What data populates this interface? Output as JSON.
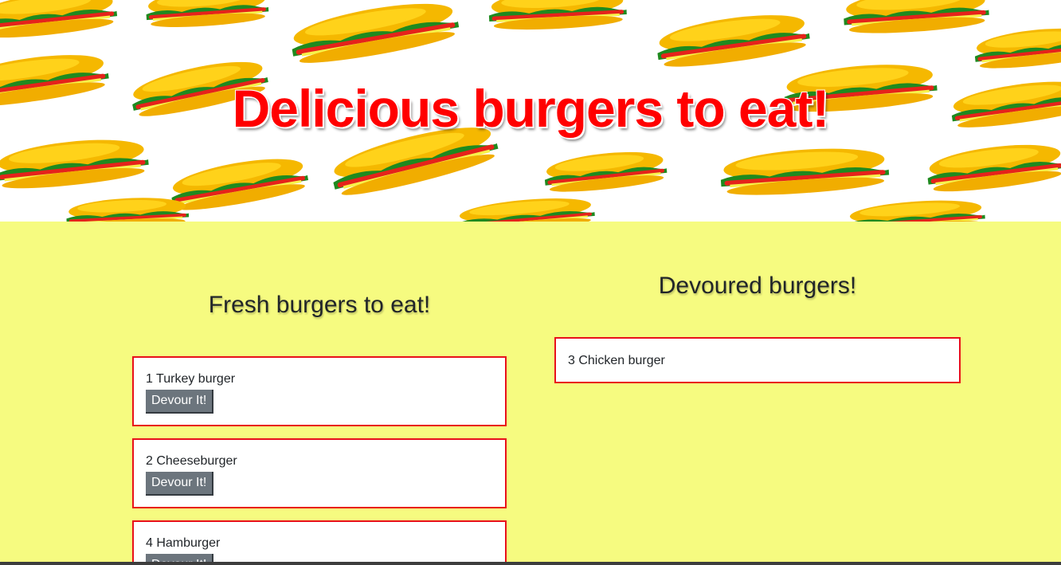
{
  "hero": {
    "title": "Delicious burgers to eat!"
  },
  "fresh": {
    "heading": "Fresh burgers to eat!",
    "burgers": [
      {
        "name": "1 Turkey burger",
        "button": "Devour It!"
      },
      {
        "name": "2 Cheeseburger",
        "button": "Devour It!"
      },
      {
        "name": "4 Hamburger",
        "button": "Devour It!"
      }
    ]
  },
  "devoured": {
    "heading": "Devoured burgers!",
    "burgers": [
      {
        "name": "3 Chicken burger"
      }
    ]
  },
  "colors": {
    "hero_title": "#ff0000",
    "main_background": "#f6fb80",
    "card_border": "#e8101a",
    "button_background": "#6c757d"
  }
}
